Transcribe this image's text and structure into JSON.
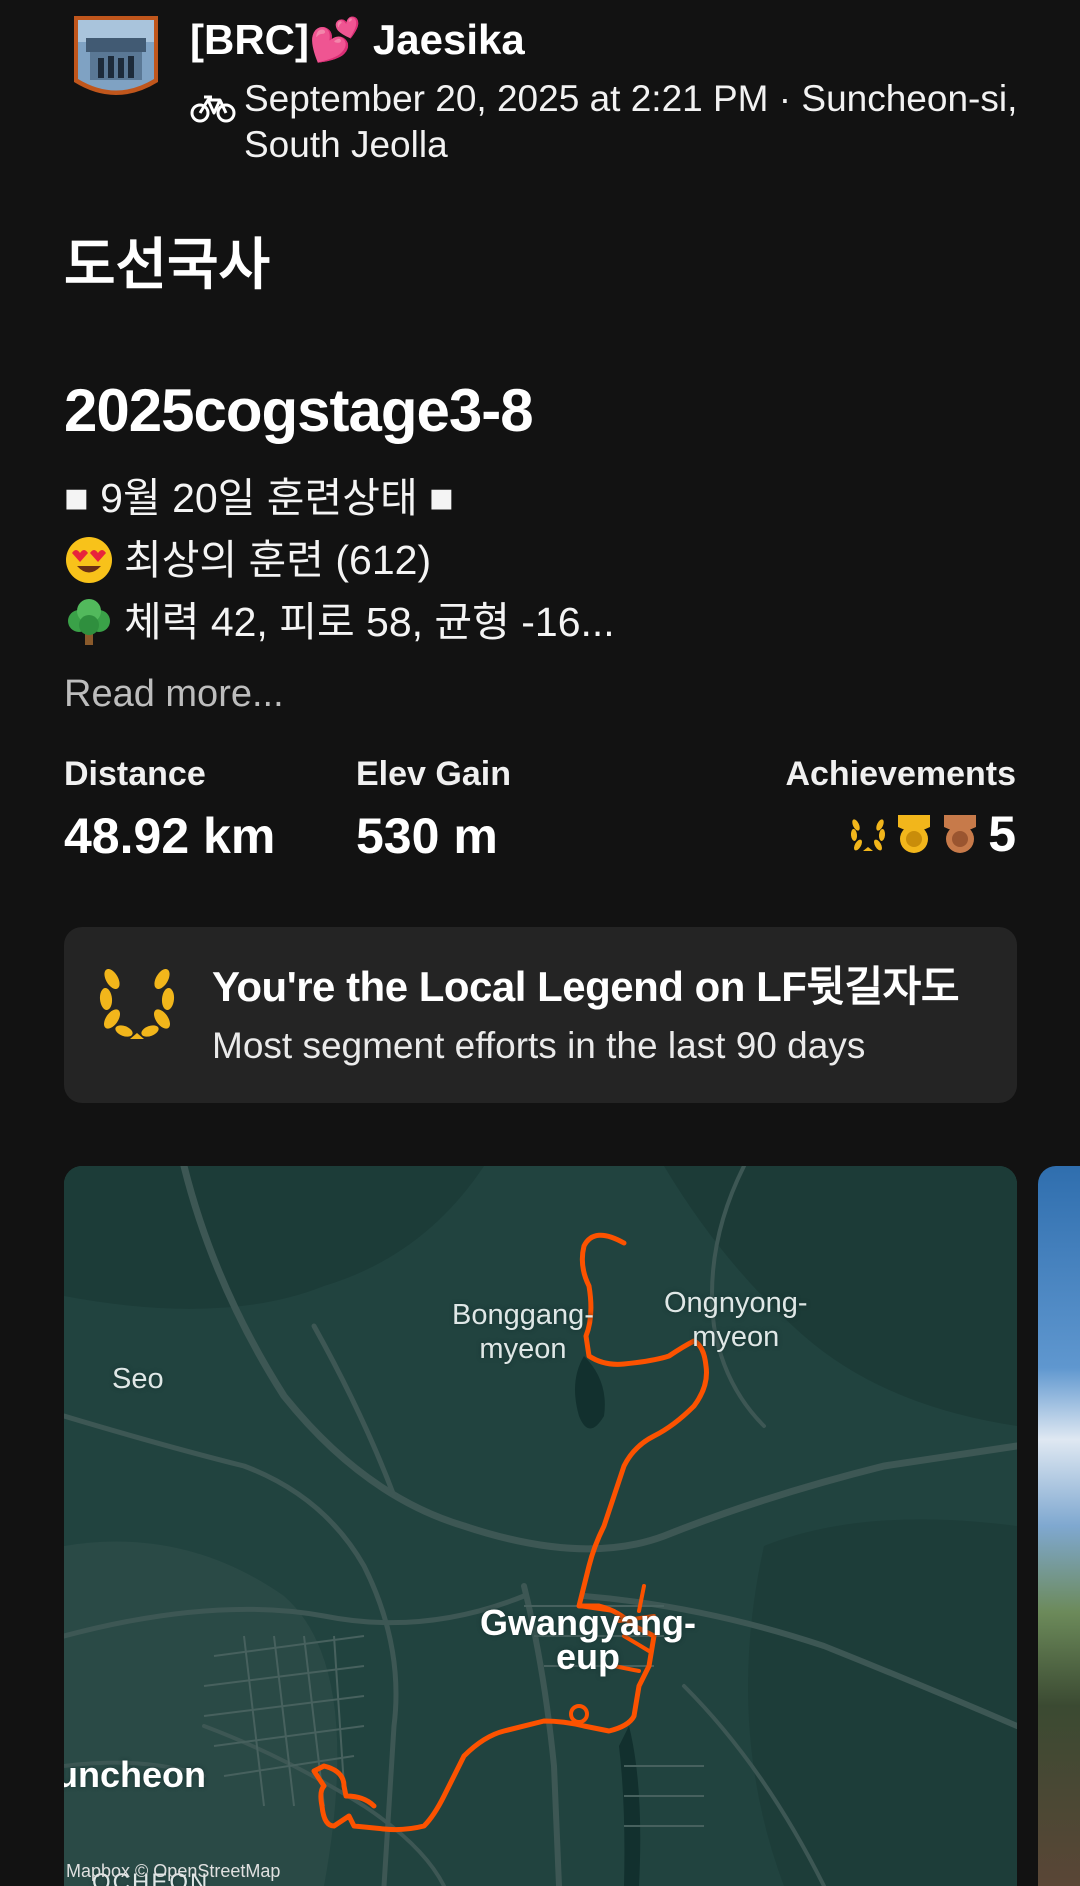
{
  "header": {
    "athlete_name": "[BRC]💕 Jaesika",
    "meta": "September 20, 2025 at 2:21 PM · Suncheon-si, South Jeolla",
    "activity_type_icon": "bike-icon"
  },
  "activity": {
    "title": "도선국사",
    "name": "2025cogstage3-8",
    "description_lines": [
      {
        "emoji": "",
        "text": "■ 9월 20일 훈련상태 ■"
      },
      {
        "emoji": "heart-eyes-emoji",
        "text": "최상의 훈련 (612)"
      },
      {
        "emoji": "tree-emoji",
        "text": "체력 42, 피로 58, 균형 -16..."
      }
    ],
    "read_more": "Read more..."
  },
  "stats": {
    "distance_label": "Distance",
    "distance_value": "48.92 km",
    "elev_label": "Elev Gain",
    "elev_value": "530 m",
    "achievements_label": "Achievements",
    "achievements_count": "5",
    "achievement_icons": [
      "laurel-icon",
      "gold-medal-icon",
      "bronze-medal-icon"
    ]
  },
  "local_legend": {
    "title": "You're the Local Legend on LF뒷길자도",
    "subtitle": "Most segment efforts in the last 90 days",
    "icon": "laurel-icon",
    "accent": "#F2B61B"
  },
  "map": {
    "labels": {
      "seo": "Seo",
      "bonggang_1": "Bonggang-",
      "bonggang_2": "myeon",
      "ongnyong_1": "Ongnyong-",
      "ongnyong_2": "myeon",
      "gwangyang_1": "Gwangyang-",
      "gwangyang_2": "eup",
      "suncheon": "uncheon",
      "bottom": "OCHEON"
    },
    "credit": "Mapbox © OpenStreetMap",
    "route_color": "#FC5200",
    "background_color": "#20403D"
  }
}
